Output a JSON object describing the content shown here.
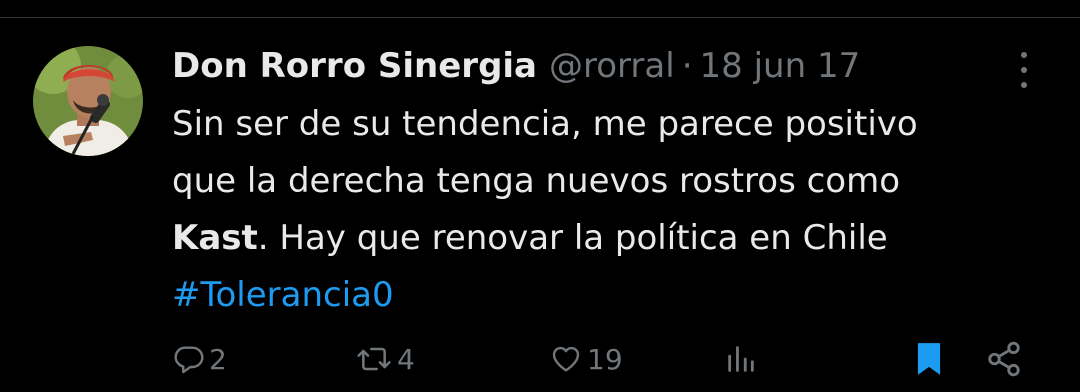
{
  "tweet": {
    "display_name": "Don Rorro Sinergia",
    "handle": "@rorral",
    "separator": "·",
    "date": "18 jun 17",
    "text": {
      "line1": "Sin ser de su tendencia, me parece positivo",
      "line2": "que la derecha tenga nuevos rostros como",
      "line3_bold": "Kast",
      "line3_rest": ". Hay que renovar la política en Chile",
      "hashtag": "#Tolerancia0"
    }
  },
  "actions": {
    "reply": {
      "icon": "reply-icon",
      "count": "2"
    },
    "retweet": {
      "icon": "retweet-icon",
      "count": "4"
    },
    "like": {
      "icon": "heart-icon",
      "count": "19"
    },
    "views": {
      "icon": "views-icon"
    },
    "bookmark": {
      "icon": "bookmark-icon",
      "active": true
    },
    "share": {
      "icon": "share-icon"
    }
  },
  "colors": {
    "background": "#000000",
    "text": "#e7e9ea",
    "muted": "#71767b",
    "accent": "#1d9bf0"
  }
}
